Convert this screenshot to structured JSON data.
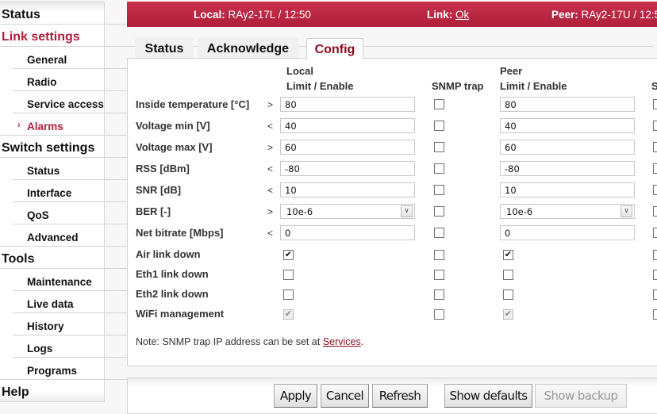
{
  "sidebar": {
    "items": [
      {
        "label": "Status",
        "level": "top",
        "active": false
      },
      {
        "label": "Link settings",
        "level": "top",
        "active": true
      },
      {
        "label": "General",
        "level": "sub",
        "active": false
      },
      {
        "label": "Radio",
        "level": "sub",
        "active": false
      },
      {
        "label": "Service access",
        "level": "sub",
        "active": false
      },
      {
        "label": "Alarms",
        "level": "sub",
        "active": true,
        "icon": "chevron-right-icon"
      },
      {
        "label": "Switch settings",
        "level": "top",
        "active": false
      },
      {
        "label": "Status",
        "level": "sub",
        "active": false
      },
      {
        "label": "Interface",
        "level": "sub",
        "active": false
      },
      {
        "label": "QoS",
        "level": "sub",
        "active": false
      },
      {
        "label": "Advanced",
        "level": "sub",
        "active": false
      },
      {
        "label": "Tools",
        "level": "top",
        "active": false
      },
      {
        "label": "Maintenance",
        "level": "sub",
        "active": false
      },
      {
        "label": "Live data",
        "level": "sub",
        "active": false
      },
      {
        "label": "History",
        "level": "sub",
        "active": false
      },
      {
        "label": "Logs",
        "level": "sub",
        "active": false
      },
      {
        "label": "Programs",
        "level": "sub",
        "active": false
      },
      {
        "label": "Help",
        "level": "top",
        "active": false
      }
    ],
    "chevron_glyph": "›"
  },
  "header": {
    "local_label": "Local:",
    "local_value": "RAy2-17L / 12:50",
    "link_label": "Link:",
    "link_value": "Ok",
    "peer_label": "Peer:",
    "peer_value": "RAy2-17U / 12:50",
    "color": "#b8243f"
  },
  "tabs": [
    {
      "label": "Status",
      "active": false
    },
    {
      "label": "Acknowledge",
      "active": false
    },
    {
      "label": "Config",
      "active": true
    }
  ],
  "table": {
    "headers": {
      "local_top": "Local",
      "local_bottom": "Limit / Enable",
      "snmp": "SNMP trap",
      "peer_top": "Peer",
      "peer_bottom": "Limit / Enable",
      "peer_snmp_partial": "S"
    },
    "value_rows": [
      {
        "label": "Inside temperature [°C]",
        "op": ">",
        "local": "80",
        "peer": "80",
        "type": "text",
        "snmp_local": false,
        "snmp_peer": false
      },
      {
        "label": "Voltage min [V]",
        "op": "<",
        "local": "40",
        "peer": "40",
        "type": "text",
        "snmp_local": false,
        "snmp_peer": false
      },
      {
        "label": "Voltage max [V]",
        "op": ">",
        "local": "60",
        "peer": "60",
        "type": "text",
        "snmp_local": false,
        "snmp_peer": false
      },
      {
        "label": "RSS [dBm]",
        "op": "<",
        "local": "-80",
        "peer": "-80",
        "type": "text",
        "snmp_local": false,
        "snmp_peer": false
      },
      {
        "label": "SNR [dB]",
        "op": "<",
        "local": "10",
        "peer": "10",
        "type": "text",
        "snmp_local": false,
        "snmp_peer": false
      },
      {
        "label": "BER [-]",
        "op": ">",
        "local": "10e-6",
        "peer": "10e-6",
        "type": "select",
        "snmp_local": false,
        "snmp_peer": false
      },
      {
        "label": "Net bitrate [Mbps]",
        "op": "<",
        "local": "0",
        "peer": "0",
        "type": "text",
        "snmp_local": false,
        "snmp_peer": false
      }
    ],
    "check_rows": [
      {
        "label": "Air link down",
        "local": true,
        "local_disabled": false,
        "snmp_local": false,
        "peer": true,
        "peer_disabled": false
      },
      {
        "label": "Eth1 link down",
        "local": false,
        "local_disabled": false,
        "snmp_local": false,
        "peer": false,
        "peer_disabled": false
      },
      {
        "label": "Eth2 link down",
        "local": false,
        "local_disabled": false,
        "snmp_local": false,
        "peer": false,
        "peer_disabled": false
      },
      {
        "label": "WiFi management",
        "local": true,
        "local_disabled": true,
        "snmp_local": false,
        "peer": true,
        "peer_disabled": true
      }
    ],
    "select_arrow_glyph": "⌄",
    "check_glyph": "✔"
  },
  "note": {
    "text": "Note: SNMP trap IP address can be set at ",
    "link": "Services",
    "suffix": "."
  },
  "buttons": {
    "apply": "Apply",
    "cancel": "Cancel",
    "refresh": "Refresh",
    "show_defaults": "Show defaults",
    "show_backup": "Show backup"
  }
}
